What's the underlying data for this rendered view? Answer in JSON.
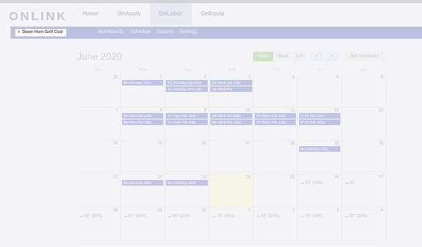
{
  "brand": {
    "logo_text": "ONLINK"
  },
  "topnav": {
    "tabs": [
      {
        "label": "Home",
        "active": false
      },
      {
        "label": "OnApply",
        "active": false
      },
      {
        "label": "OnLabor",
        "active": true
      },
      {
        "label": "OnEquip",
        "active": false
      }
    ]
  },
  "subnav": {
    "club_selected": "Dawn Horn Golf Club",
    "links": [
      "Workboards",
      "Schedule",
      "Reports",
      "Settings"
    ]
  },
  "calendar": {
    "title": "June 2020",
    "view_buttons": {
      "month": "Month",
      "week": "Week",
      "list": "List"
    },
    "prev_icon": "chevron-left-icon",
    "next_icon": "chevron-right-icon",
    "add_workboard_label": "Add Workboard",
    "weekday_headers": [
      "Sun",
      "Mon",
      "Tue",
      "Wed",
      "Thu",
      "Fri",
      "Sat"
    ],
    "weeks": [
      {
        "days": [
          "31",
          "1",
          "2",
          "3",
          "4",
          "5",
          "6"
        ]
      },
      {
        "days": [
          "7",
          "8",
          "9",
          "10",
          "11",
          "12",
          "13"
        ]
      },
      {
        "days": [
          "14",
          "15",
          "16",
          "17",
          "18",
          "19",
          "20"
        ]
      },
      {
        "days": [
          "21",
          "22",
          "23",
          "24",
          "25",
          "26",
          "27"
        ]
      },
      {
        "days": [
          "28",
          "29",
          "30",
          "1",
          "2",
          "3",
          "4"
        ]
      }
    ],
    "events": [
      {
        "week": 0,
        "day": 1,
        "slot": 0,
        "label": "Mo Monday Jobs"
      },
      {
        "week": 0,
        "day": 2,
        "slot": 0,
        "label": "Tu Tuesday AM Jobs"
      },
      {
        "week": 0,
        "day": 2,
        "slot": 1,
        "label": "Tu Tuesday PM Jobs"
      },
      {
        "week": 0,
        "day": 3,
        "slot": 0,
        "label": "We Wed AM Jobs"
      },
      {
        "week": 0,
        "day": 3,
        "slot": 1,
        "label": "We Wed PM"
      },
      {
        "week": 1,
        "day": 1,
        "slot": 0,
        "label": "Mo Mon AM Jobs"
      },
      {
        "week": 1,
        "day": 1,
        "slot": 1,
        "label": "Mo Mon PM Jobs"
      },
      {
        "week": 1,
        "day": 2,
        "slot": 0,
        "label": "Tu Tues AM Jobs"
      },
      {
        "week": 1,
        "day": 2,
        "slot": 1,
        "label": "Tu Tues PM Jobs"
      },
      {
        "week": 1,
        "day": 3,
        "slot": 0,
        "label": "We Wed AM Jobs"
      },
      {
        "week": 1,
        "day": 3,
        "slot": 1,
        "label": "We Wed PM Jobs"
      },
      {
        "week": 1,
        "day": 4,
        "slot": 0,
        "label": "Th Thurs AM Jobs"
      },
      {
        "week": 1,
        "day": 4,
        "slot": 1,
        "label": "Th Thurs PM Jobs"
      },
      {
        "week": 1,
        "day": 5,
        "slot": 0,
        "label": "Fr Fri AM Jobs"
      },
      {
        "week": 1,
        "day": 5,
        "slot": 1,
        "label": "Fr Fri PM Jobs"
      },
      {
        "week": 2,
        "day": 5,
        "slot": 0,
        "label": "Mo Monday Jobs"
      },
      {
        "week": 3,
        "day": 1,
        "slot": 0,
        "label": "Mo Morning Jobs"
      },
      {
        "week": 3,
        "day": 2,
        "slot": 0,
        "label": "Mo Morning Jobs"
      }
    ],
    "weather": [
      {
        "week": 3,
        "day": 5,
        "text": "93° (30%)"
      },
      {
        "week": 3,
        "day": 6,
        "text": "61°"
      },
      {
        "week": 4,
        "day": 0,
        "text": "90° (60%)"
      },
      {
        "week": 4,
        "day": 1,
        "text": "81° (40%)"
      },
      {
        "week": 4,
        "day": 2,
        "text": "85° (20%)"
      },
      {
        "week": 4,
        "day": 3,
        "text": "73° (40%)"
      },
      {
        "week": 4,
        "day": 4,
        "text": "58° (20%)"
      },
      {
        "week": 4,
        "day": 5,
        "text": "79° (50%)"
      },
      {
        "week": 4,
        "day": 6,
        "text": "83° (30%)"
      }
    ],
    "today": {
      "week": 3,
      "day": 3
    }
  },
  "colors": {
    "accent": "#bcc1e2",
    "event": "#bfc3e6",
    "month_button": "#cfe3c5",
    "today_cell": "#f7f6e6"
  }
}
